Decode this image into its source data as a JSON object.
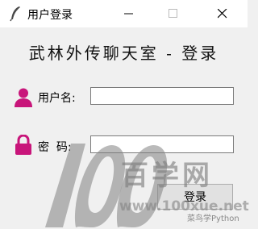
{
  "window": {
    "title": "用户登录",
    "icon": "feather-icon"
  },
  "heading": "武林外传聊天室 - 登录",
  "form": {
    "username_label": "用户名:",
    "username_value": "",
    "password_label": "密  码:",
    "password_value": "",
    "submit_label": "登录"
  },
  "watermark": {
    "number": "100",
    "text": "百学网",
    "url": "www.100xue.net",
    "credit": "菜鸟学Python"
  },
  "colors": {
    "accent": "#c8157a",
    "window_bg": "#f0f0f0",
    "titlebar_bg": "#ffffff"
  }
}
